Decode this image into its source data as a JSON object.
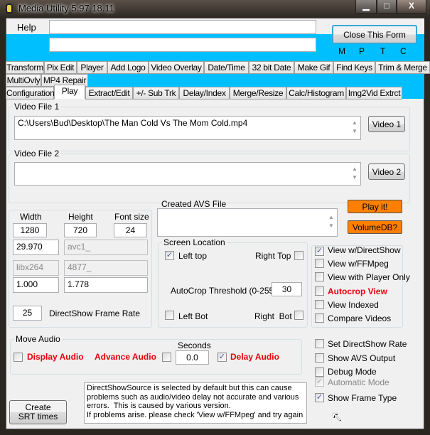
{
  "window": {
    "title": "Media Utility 5.97.18.11",
    "minimize": "▁",
    "maximize": "□",
    "close": "X"
  },
  "header": {
    "help": "Help",
    "close_form": "Close This Form",
    "field1": "",
    "field2": "",
    "flags": [
      "M",
      "P",
      "T",
      "C"
    ]
  },
  "tabs_row1": [
    "Transform",
    "Pix Edit",
    "Player",
    "Add Logo",
    "Video Overlay",
    "Date/Time",
    "32 bit Date",
    "Make Gif",
    "Find Keys",
    "Trim & Merge"
  ],
  "tabs_row2": [
    "MultiOvly",
    "MP4 Repair"
  ],
  "tabs_row3": [
    "Configuration",
    "Play",
    "Extract/Edit",
    "+/- Sub Trk",
    "Delay/Index",
    "Merge/Resize",
    "Calc/Histogram",
    "Img2Vid Extrct"
  ],
  "video1": {
    "label": "Video File 1",
    "value": "C:\\Users\\Bud\\Desktop\\The Man Cold Vs The Mom Cold.mp4",
    "button": "Video 1"
  },
  "video2": {
    "label": "Video File 2",
    "value": "",
    "button": "Video 2"
  },
  "dims": {
    "width_label": "Width",
    "height_label": "Height",
    "font_label": "Font size",
    "width": "1280",
    "height": "720",
    "font_size": "24",
    "fps": "29.970",
    "codec_in": "avc1_",
    "codec_out": "libx264",
    "bitrate": "4877_",
    "par": "1.000",
    "dar": "1.778",
    "ds_rate": "25",
    "ds_rate_label": "DirectShow Frame Rate"
  },
  "avs": {
    "label": "Created AVS File",
    "value": "",
    "play": "Play it!",
    "volume": "VolumeDB?"
  },
  "screen": {
    "label": "Screen Location",
    "left_top": "Left top",
    "right_top": "Right Top",
    "autocrop_label": "AutoCrop Threshold (0-255)",
    "autocrop": "30",
    "left_bot": "Left Bot",
    "right_bot": "Right  Bot",
    "left_top_checked": true
  },
  "view_options": [
    {
      "label": "View w/DirectShow",
      "checked": true
    },
    {
      "label": "View w/FFMpeg",
      "checked": false
    },
    {
      "label": "View with Player Only",
      "checked": false
    },
    {
      "label": "Autocrop View",
      "checked": false,
      "red": true
    },
    {
      "label": "View Indexed",
      "checked": false
    },
    {
      "label": "Compare Videos",
      "checked": false
    }
  ],
  "audio": {
    "label": "Move Audio",
    "display": "Display Audio",
    "advance": "Advance Audio",
    "seconds_label": "Seconds",
    "seconds": "0.0",
    "delay": "Delay Audio",
    "delay_checked": true
  },
  "options": [
    {
      "label": "Set DirectShow Rate",
      "checked": false
    },
    {
      "label": "Show AVS Output",
      "checked": false
    },
    {
      "label": "Debug Mode",
      "checked": false
    },
    {
      "label": "Automatic Mode",
      "checked": true,
      "disabled": true
    },
    {
      "label": "Show Frame Type",
      "checked": true
    }
  ],
  "srt_button": "Create SRT times",
  "info": "DirectShowSource is selected by default but this can cause problems such as audio/video delay not accurate and various errors.  This is caused by various version.\nIf problems arise. please check 'View w/FFMpeg' and try again",
  "colors": {
    "accent": "#00bfff",
    "orange": "#ff8000",
    "red": "#e8000b"
  }
}
